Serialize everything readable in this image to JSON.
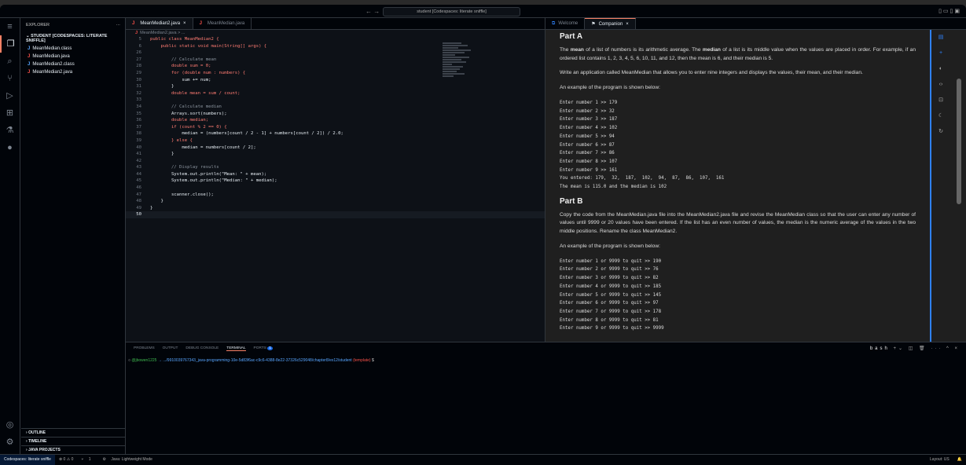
{
  "titlebar": {
    "search": "student [Codespaces: literate sniffle]",
    "nav": "← →"
  },
  "explorer": {
    "title": "EXPLORER",
    "root": "STUDENT [CODESPACES: LITERATE SNIFFLE]",
    "files": [
      {
        "name": "MeanMedian.class",
        "type": "class"
      },
      {
        "name": "MeanMedian.java",
        "type": "java"
      },
      {
        "name": "MeanMedian2.class",
        "type": "class"
      },
      {
        "name": "MeanMedian2.java",
        "type": "java"
      }
    ],
    "sections": [
      "OUTLINE",
      "TIMELINE",
      "JAVA PROJECTS"
    ]
  },
  "editor": {
    "tabs": [
      "MeanMedian2.java",
      "MeanMedian.java"
    ],
    "breadcrumb": "MeanMedian2.java > ...",
    "lines": [
      {
        "n": "5",
        "t": "public class MeanMedian2 {"
      },
      {
        "n": "6",
        "t": "    public static void main(String[] args) {"
      },
      {
        "n": "26",
        "t": ""
      },
      {
        "n": "27",
        "t": "        // Calculate mean"
      },
      {
        "n": "28",
        "t": "        double sum = 0;"
      },
      {
        "n": "29",
        "t": "        for (double num : numbers) {"
      },
      {
        "n": "30",
        "t": "            sum += num;"
      },
      {
        "n": "31",
        "t": "        }"
      },
      {
        "n": "32",
        "t": "        double mean = sum / count;"
      },
      {
        "n": "33",
        "t": ""
      },
      {
        "n": "34",
        "t": "        // Calculate median"
      },
      {
        "n": "35",
        "t": "        Arrays.sort(numbers);"
      },
      {
        "n": "36",
        "t": "        double median;"
      },
      {
        "n": "37",
        "t": "        if (count % 2 == 0) {"
      },
      {
        "n": "38",
        "t": "            median = (numbers[count / 2 - 1] + numbers[count / 2]) / 2.0;"
      },
      {
        "n": "39",
        "t": "        } else {"
      },
      {
        "n": "40",
        "t": "            median = numbers[count / 2];"
      },
      {
        "n": "41",
        "t": "        }"
      },
      {
        "n": "42",
        "t": ""
      },
      {
        "n": "43",
        "t": "        // Display results"
      },
      {
        "n": "44",
        "t": "        System.out.println(\"Mean: \" + mean);"
      },
      {
        "n": "45",
        "t": "        System.out.println(\"Median: \" + median);"
      },
      {
        "n": "46",
        "t": ""
      },
      {
        "n": "47",
        "t": "        scanner.close();"
      },
      {
        "n": "48",
        "t": "    }"
      },
      {
        "n": "49",
        "t": "}"
      },
      {
        "n": "50",
        "t": ""
      }
    ]
  },
  "companion": {
    "tabs": [
      "Welcome",
      "Companion"
    ],
    "partA": {
      "title": "Part A",
      "p1_a": "The ",
      "p1_b1": "mean",
      "p1_c": " of a list of numbers is its arithmetic average. The ",
      "p1_b2": "median",
      "p1_d": " of a list is its middle value when the values are placed in order. For example, if an ordered list contains 1, 2, 3, 4, 5, 6, 10, 11, and 12, then the mean is 6, and their median is 5.",
      "p2": "Write an application called MeanMedian that allows you to enter nine integers and displays the values, their mean, and their median.",
      "p3": "An example of the program is shown below:",
      "example": "Enter number 1 >> 179\nEnter number 2 >> 32\nEnter number 3 >> 187\nEnter number 4 >> 102\nEnter number 5 >> 94\nEnter number 6 >> 87\nEnter number 7 >> 86\nEnter number 8 >> 107\nEnter number 9 >> 161\nYou entered: 179,  32,  187,  102,  94,  87,  86,  107,  161\nThe mean is 115.0 and the median is 102"
    },
    "partB": {
      "title": "Part B",
      "p1": "Copy the code from the MeanMedian.java file into the MeanMedian2.java file and revise the MeanMedian class so that the user can enter any number of values until 9999 or 20 values have been entered. If the list has an even number of values, the median is the numeric average of the values in the two middle positions. Rename the class MeanMedian2.",
      "p2": "An example of the program is shown below:",
      "example": "Enter number 1 or 9999 to quit >> 190\nEnter number 2 or 9999 to quit >> 76\nEnter number 3 or 9999 to quit >> 82\nEnter number 4 or 9999 to quit >> 185\nEnter number 5 or 9999 to quit >> 145\nEnter number 6 or 9999 to quit >> 97\nEnter number 7 or 9999 to quit >> 178\nEnter number 8 or 9999 to quit >> 81\nEnter number 9 or 9999 to quit >> 9999"
    }
  },
  "panel": {
    "tabs": [
      "PROBLEMS",
      "OUTPUT",
      "DEBUG CONSOLE",
      "TERMINAL",
      "PORTS"
    ],
    "ports_badge": "1",
    "shell": "bash",
    "prompt_user": "@jbowen1225",
    "prompt_path": "→ .../9910039767343_java-programming-10e-5d83f6ac-c9c6-4388-8e22-37326c529048/chapter8/ex12/student",
    "prompt_branch": "(template)",
    "prompt_end": "$"
  },
  "status": {
    "remote": "Codespaces: literate sniffle",
    "problems": "⊗ 0 ⚠ 0",
    "ports": "1",
    "java": "Java: Lightweight Mode",
    "layout": "Layout: US"
  }
}
